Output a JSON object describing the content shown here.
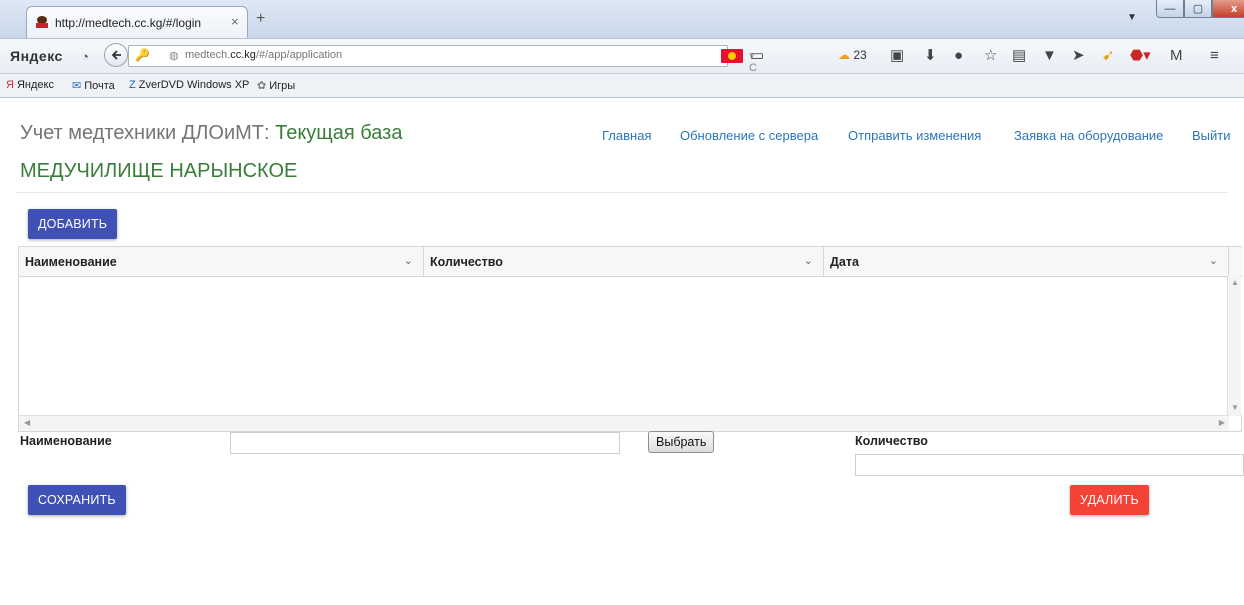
{
  "browser": {
    "tab": {
      "title": "http://medtech.cc.kg/#/login",
      "close": "×"
    },
    "new_tab": "+",
    "url": {
      "host_prefix": "medtech.",
      "host_domain": "cc.kg",
      "path": "/#/app/application"
    },
    "yandex_label": "Яндекс",
    "weather_temp": "23",
    "window": {
      "minimize": "—",
      "maximize": "▢",
      "close": "x"
    },
    "bookmarks": [
      {
        "label": "Яндекс",
        "icon": "yandex-icon"
      },
      {
        "label": "Почта",
        "icon": "mail-icon"
      },
      {
        "label": "ZverDVD Windows XP",
        "icon": "zverdvd-icon"
      },
      {
        "label": "Игры",
        "icon": "games-icon"
      }
    ]
  },
  "header": {
    "title": "Учет медтехники ДЛОиМТ: ",
    "db_label": "Текущая база",
    "institution": "МЕДУЧИЛИЩЕ НАРЫНСКОЕ",
    "nav": [
      "Главная",
      "Обновление с сервера",
      "Отправить изменения",
      "Заявка на оборудование",
      "Выйти"
    ]
  },
  "buttons": {
    "add": "ДОБАВИТЬ",
    "save": "СОХРАНИТЬ",
    "delete": "УДАЛИТЬ",
    "select": "Выбрать"
  },
  "grid": {
    "columns": [
      "Наименование",
      "Количество",
      "Дата"
    ],
    "rows": []
  },
  "form": {
    "name_label": "Наименование",
    "name_value": "",
    "qty_label": "Количество",
    "qty_value": ""
  },
  "colors": {
    "primary": "#3f51b5",
    "danger": "#f44336",
    "green": "#3a7d3a",
    "link": "#2c76b8"
  }
}
